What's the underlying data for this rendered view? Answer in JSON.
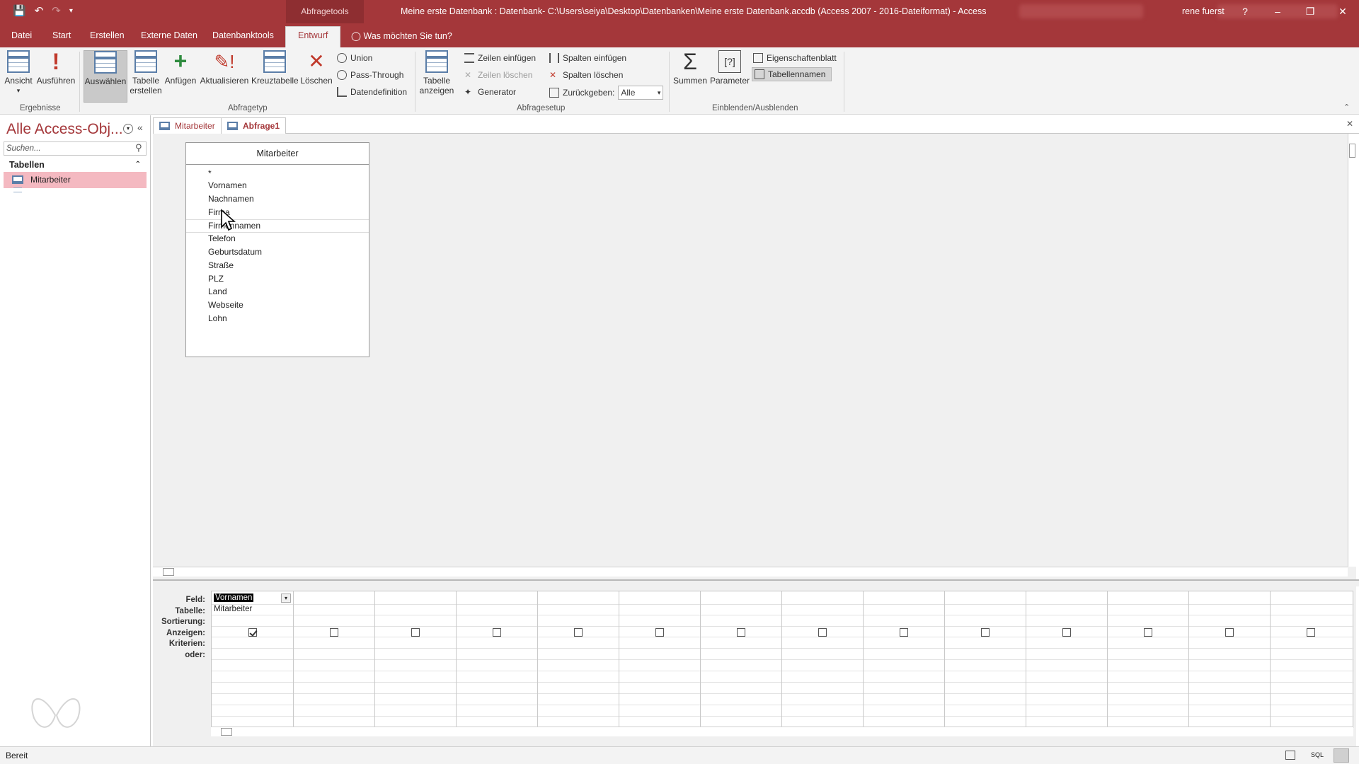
{
  "titlebar": {
    "context_tab": "Abfragetools",
    "title": "Meine erste Datenbank : Datenbank- C:\\Users\\seiya\\Desktop\\Datenbanken\\Meine erste Datenbank.accdb (Access 2007 - 2016-Dateiformat)  -  Access",
    "user": "rene fuerst",
    "help": "?",
    "minimize": "–",
    "restore": "❐",
    "close": "✕",
    "color": "#a4373a"
  },
  "tabs": [
    {
      "label": "Datei"
    },
    {
      "label": "Start"
    },
    {
      "label": "Erstellen"
    },
    {
      "label": "Externe Daten"
    },
    {
      "label": "Datenbanktools"
    },
    {
      "label": "Entwurf",
      "active": true
    }
  ],
  "tell_me": "Was möchten Sie tun?",
  "ribbon": {
    "ergebnisse": {
      "label": "Ergebnisse",
      "ansicht": "Ansicht",
      "ausfuehren": "Ausführen"
    },
    "abfragetyp": {
      "label": "Abfragetyp",
      "auswaehlen": "Auswählen",
      "tabelle_erstellen_1": "Tabelle",
      "tabelle_erstellen_2": "erstellen",
      "anfuegen": "Anfügen",
      "aktualisieren": "Aktualisieren",
      "kreuztabelle": "Kreuztabelle",
      "loeschen": "Löschen",
      "union": "Union",
      "pass_through": "Pass-Through",
      "datendefinition": "Datendefinition"
    },
    "abfragesetup": {
      "label": "Abfragesetup",
      "tabelle_anzeigen_1": "Tabelle",
      "tabelle_anzeigen_2": "anzeigen",
      "zeilen_einfuegen": "Zeilen einfügen",
      "zeilen_loeschen": "Zeilen löschen",
      "generator": "Generator",
      "spalten_einfuegen": "Spalten einfügen",
      "spalten_loeschen": "Spalten löschen",
      "zurueckgeben": "Zurückgeben:",
      "zurueckgeben_value": "Alle"
    },
    "einblenden": {
      "label": "Einblenden/Ausblenden",
      "summen": "Summen",
      "parameter": "Parameter",
      "eigenschaftenblatt": "Eigenschaftenblatt",
      "tabellennamen": "Tabellennamen"
    }
  },
  "navpane": {
    "title": "Alle Access-Obj...",
    "search_placeholder": "Suchen...",
    "group": "Tabellen",
    "items": [
      {
        "label": "Mitarbeiter"
      }
    ]
  },
  "doctabs": [
    {
      "label": "Mitarbeiter"
    },
    {
      "label": "Abfrage1",
      "active": true
    }
  ],
  "table": {
    "name": "Mitarbeiter",
    "fields": [
      "*",
      "Vornamen",
      "Nachnamen",
      "Firma",
      "Firmennamen",
      "Telefon",
      "Geburtsdatum",
      "Straße",
      "PLZ",
      "Land",
      "Webseite",
      "Lohn"
    ]
  },
  "qbe": {
    "row_labels": [
      "Feld:",
      "Tabelle:",
      "Sortierung:",
      "Anzeigen:",
      "Kriterien:",
      "oder:"
    ],
    "columns": [
      {
        "feld": "Vornamen",
        "tabelle": "Mitarbeiter",
        "anzeigen": true
      },
      {
        "feld": "",
        "tabelle": "",
        "anzeigen": false
      },
      {
        "feld": "",
        "tabelle": "",
        "anzeigen": false
      },
      {
        "feld": "",
        "tabelle": "",
        "anzeigen": false
      },
      {
        "feld": "",
        "tabelle": "",
        "anzeigen": false
      },
      {
        "feld": "",
        "tabelle": "",
        "anzeigen": false
      },
      {
        "feld": "",
        "tabelle": "",
        "anzeigen": false
      },
      {
        "feld": "",
        "tabelle": "",
        "anzeigen": false
      },
      {
        "feld": "",
        "tabelle": "",
        "anzeigen": false
      },
      {
        "feld": "",
        "tabelle": "",
        "anzeigen": false
      },
      {
        "feld": "",
        "tabelle": "",
        "anzeigen": false
      },
      {
        "feld": "",
        "tabelle": "",
        "anzeigen": false
      },
      {
        "feld": "",
        "tabelle": "",
        "anzeigen": false
      },
      {
        "feld": "",
        "tabelle": "",
        "anzeigen": false
      }
    ]
  },
  "status": {
    "text": "Bereit",
    "sql_label": "SQL"
  }
}
